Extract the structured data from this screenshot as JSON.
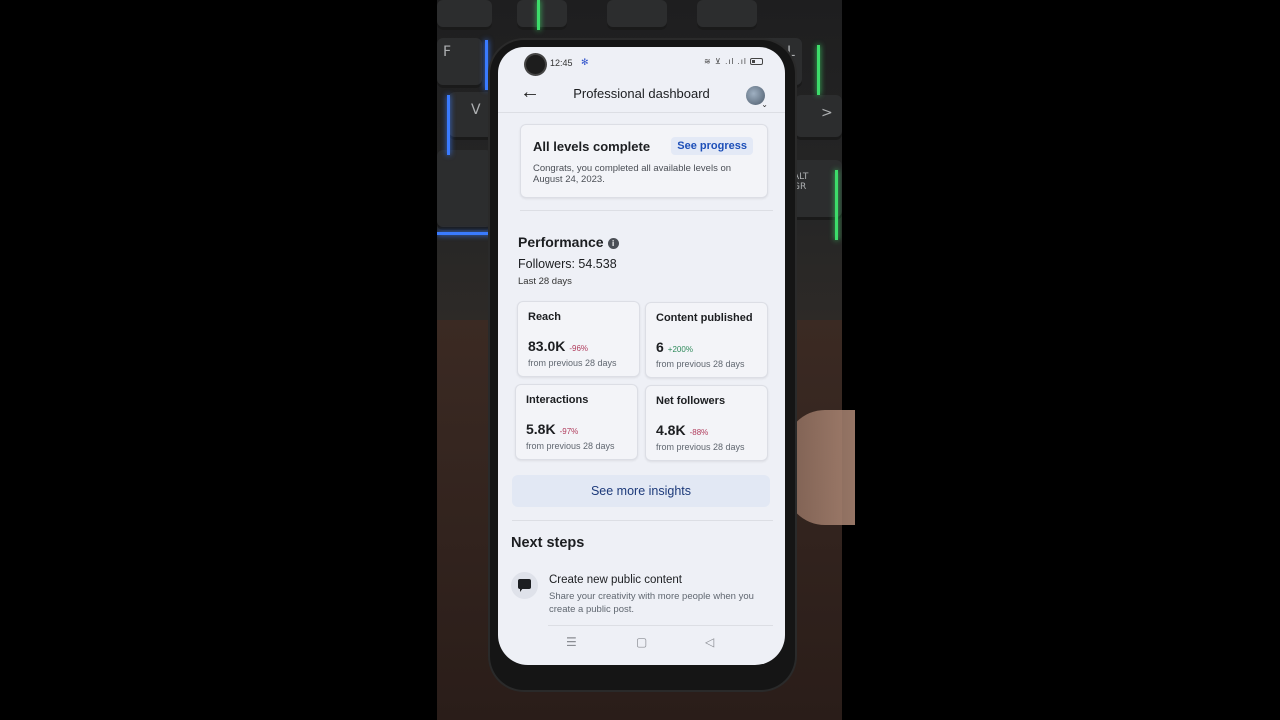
{
  "status_bar": {
    "time": "12:45",
    "settings_icon": "gear-icon",
    "signal_icons": "wifi-icon, volte-icon, signal-icon, signal-icon, battery-icon"
  },
  "app_bar": {
    "back_icon": "←",
    "title": "Professional dashboard",
    "avatar_icon": "profile-avatar"
  },
  "levels_card": {
    "title": "All levels complete",
    "button": "See progress",
    "description": "Congrats, you completed all available levels on August 24, 2023."
  },
  "performance": {
    "title": "Performance",
    "info_icon": "i",
    "followers": "Followers: 54.538",
    "period": "Last 28 days",
    "stats": [
      {
        "label": "Reach",
        "value": "83.0K",
        "change": "-96%",
        "trend": "negative",
        "sub": "from previous 28 days"
      },
      {
        "label": "Content published",
        "value": "6",
        "change": "+200%",
        "trend": "positive",
        "sub": "from previous 28 days"
      },
      {
        "label": "Interactions",
        "value": "5.8K",
        "change": "-97%",
        "trend": "negative",
        "sub": "from previous 28 days"
      },
      {
        "label": "Net followers",
        "value": "4.8K",
        "change": "-88%",
        "trend": "negative",
        "sub": "from previous 28 days"
      }
    ],
    "insights_button": "See more insights"
  },
  "next_steps": {
    "title": "Next steps",
    "items": [
      {
        "icon": "chat-bubble-icon",
        "title": "Create new public content",
        "description": "Share your creativity with more people when you create a public post."
      }
    ]
  },
  "nav_bar": {
    "menu": "☰",
    "home": "▢",
    "back": "◁"
  },
  "keyboard_keys": [
    "F",
    "V",
    "L",
    ">",
    "ALT GR"
  ],
  "colors": {
    "accent": "#1d4fb8",
    "negative": "#b03b5c",
    "positive": "#2f8a5b",
    "screen_bg": "#eef0f6"
  }
}
